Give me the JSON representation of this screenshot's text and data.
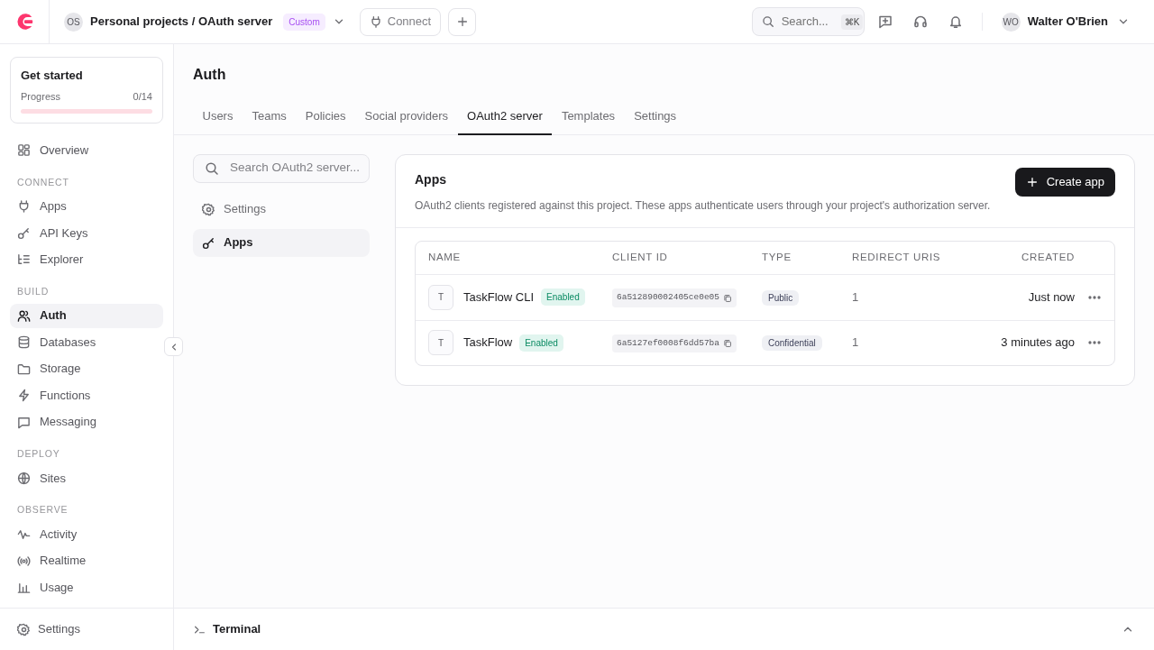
{
  "header": {
    "project_initials": "OS",
    "project": "Personal projects / OAuth server",
    "plan_badge": "Custom",
    "connect_button": "Connect",
    "search": {
      "placeholder": "Search...",
      "shortcut": "⌘K"
    },
    "user": {
      "initials": "WO",
      "name": "Walter O'Brien"
    }
  },
  "get_started": {
    "title": "Get started",
    "label": "Progress",
    "count": "0/14",
    "level": 0
  },
  "sidebar": {
    "items": [
      {
        "kind": "item",
        "label": "Overview",
        "selected": false
      },
      {
        "kind": "section",
        "label": "CONNECT"
      },
      {
        "kind": "item",
        "label": "Apps",
        "selected": false
      },
      {
        "kind": "item",
        "label": "API Keys",
        "selected": false
      },
      {
        "kind": "item",
        "label": "Explorer",
        "selected": false
      },
      {
        "kind": "section",
        "label": "BUILD"
      },
      {
        "kind": "item",
        "label": "Auth",
        "selected": true
      },
      {
        "kind": "item",
        "label": "Databases",
        "selected": false
      },
      {
        "kind": "item",
        "label": "Storage",
        "selected": false
      },
      {
        "kind": "item",
        "label": "Functions",
        "selected": false
      },
      {
        "kind": "item",
        "label": "Messaging",
        "selected": false
      },
      {
        "kind": "section",
        "label": "DEPLOY"
      },
      {
        "kind": "item",
        "label": "Sites",
        "selected": false
      },
      {
        "kind": "section",
        "label": "OBSERVE"
      },
      {
        "kind": "item",
        "label": "Activity",
        "selected": false
      },
      {
        "kind": "item",
        "label": "Realtime",
        "selected": false
      },
      {
        "kind": "item",
        "label": "Usage",
        "selected": false
      }
    ],
    "footer_item": "Settings"
  },
  "page_title": "Auth",
  "tabs": [
    {
      "label": "Users",
      "selected": false
    },
    {
      "label": "Teams",
      "selected": false
    },
    {
      "label": "Policies",
      "selected": false
    },
    {
      "label": "Social providers",
      "selected": false
    },
    {
      "label": "OAuth2 server",
      "selected": true
    },
    {
      "label": "Templates",
      "selected": false
    },
    {
      "label": "Settings",
      "selected": false
    }
  ],
  "subnav": {
    "search_placeholder": "Search OAuth2 server...",
    "items": [
      {
        "label": "Settings",
        "selected": false
      },
      {
        "label": "Apps",
        "selected": true
      }
    ]
  },
  "panel": {
    "title": "Apps",
    "description": "OAuth2 clients registered against this project. These apps authenticate users through your project's authorization server.",
    "create_button": "Create app",
    "table": {
      "columns": [
        "NAME",
        "CLIENT ID",
        "TYPE",
        "REDIRECT URIS",
        "CREATED"
      ],
      "rows": [
        {
          "avatar": "T",
          "name": "TaskFlow CLI",
          "status": "Enabled",
          "client_id": "6a512890002405ce0e05",
          "type": "Public",
          "redirect_uris": "1",
          "created": "Just now"
        },
        {
          "avatar": "T",
          "name": "TaskFlow",
          "status": "Enabled",
          "client_id": "6a5127ef0008f6dd57ba",
          "type": "Confidential",
          "redirect_uris": "1",
          "created": "3 minutes ago"
        }
      ]
    }
  },
  "terminal": {
    "label": "Terminal"
  }
}
